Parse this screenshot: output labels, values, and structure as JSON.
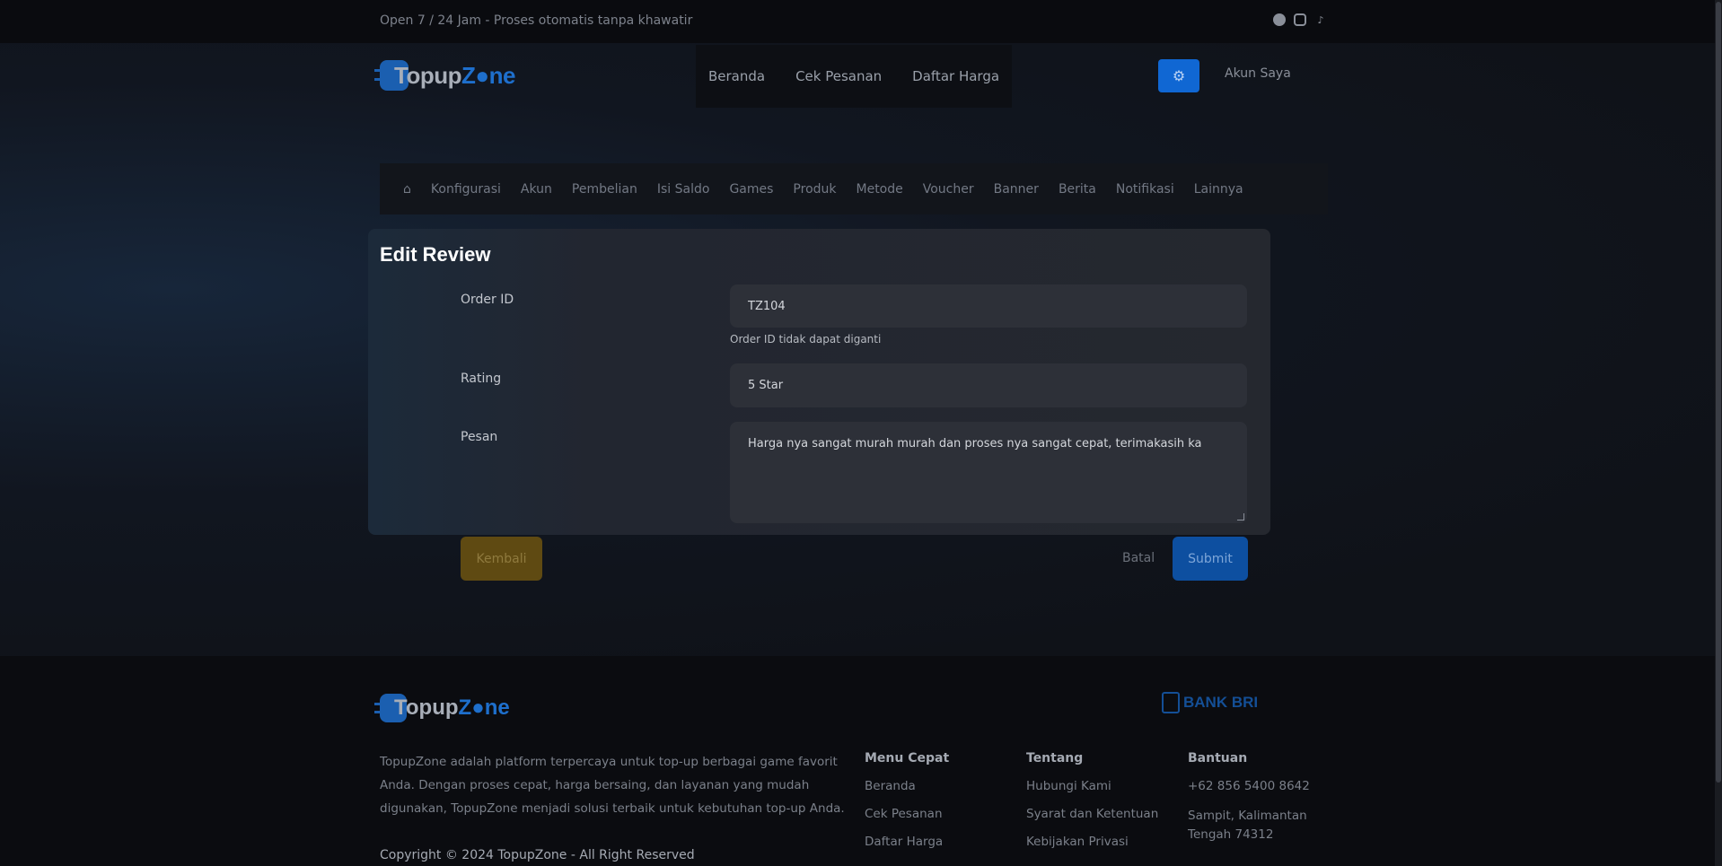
{
  "topbar": {
    "open_text": "Open 7 / 24 Jam - Proses otomatis tanpa khawatir",
    "socials": [
      "whatsapp-icon",
      "instagram-icon",
      "tiktok-icon"
    ]
  },
  "header": {
    "logo_text_a": "Topup",
    "logo_text_b": "Z",
    "logo_text_c": "ne",
    "nav": [
      "Beranda",
      "Cek Pesanan",
      "Daftar Harga"
    ],
    "account_label": "Akun Saya"
  },
  "admin_menu": {
    "items": [
      "Konfigurasi",
      "Akun",
      "Pembelian",
      "Isi Saldo",
      "Games",
      "Produk",
      "Metode",
      "Voucher",
      "Banner",
      "Berita",
      "Notifikasi",
      "Lainnya"
    ]
  },
  "form": {
    "title": "Edit Review",
    "order_id_label": "Order ID",
    "order_id_value": "TZ104",
    "order_id_help": "Order ID tidak dapat diganti",
    "rating_label": "Rating",
    "rating_value": "5 Star",
    "message_label": "Pesan",
    "message_value": "Harga nya sangat murah murah dan proses nya sangat cepat, terimakasih ka",
    "back_label": "Kembali",
    "cancel_label": "Batal",
    "submit_label": "Submit"
  },
  "footer": {
    "bank_label": "BANK BRI",
    "description": "TopupZone adalah platform terpercaya untuk top-up berbagai game favorit Anda. Dengan proses cepat, harga bersaing, dan layanan yang mudah digunakan, TopupZone menjadi solusi terbaik untuk kebutuhan top-up Anda.",
    "copyright": "Copyright © 2024 TopupZone - All Right Reserved",
    "col1": {
      "head": "Menu Cepat",
      "items": [
        "Beranda",
        "Cek Pesanan",
        "Daftar Harga"
      ]
    },
    "col2": {
      "head": "Tentang",
      "items": [
        "Hubungi Kami",
        "Syarat dan Ketentuan",
        "Kebijakan Privasi"
      ]
    },
    "col3": {
      "head": "Bantuan",
      "phone": "+62 856 5400 8642",
      "address": "Sampit, Kalimantan Tengah 74312"
    }
  },
  "colors": {
    "accent": "#1067d3",
    "back_button": "#5f4a12",
    "submit_button": "#0d4fa0"
  }
}
